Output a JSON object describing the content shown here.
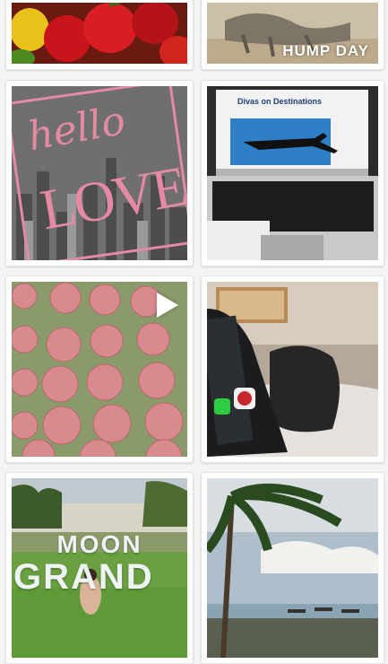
{
  "tiles": [
    {
      "id": "peppers",
      "alt": "photo of red and yellow bell peppers"
    },
    {
      "id": "hump-day",
      "overlay": "HUMP DAY"
    },
    {
      "id": "hello-love",
      "line1": "hello",
      "line2": "LOVE"
    },
    {
      "id": "laptop",
      "site_title": "Divas on Destinations"
    },
    {
      "id": "macarons",
      "is_video": true
    },
    {
      "id": "phone-bed"
    },
    {
      "id": "moon-grand",
      "line1": "MOON",
      "line2": "GRAND"
    },
    {
      "id": "beach"
    }
  ],
  "colors": {
    "background": "#f4f4f4",
    "tile_border": "#e3e3e3",
    "love_pink": "#e58aa3"
  }
}
